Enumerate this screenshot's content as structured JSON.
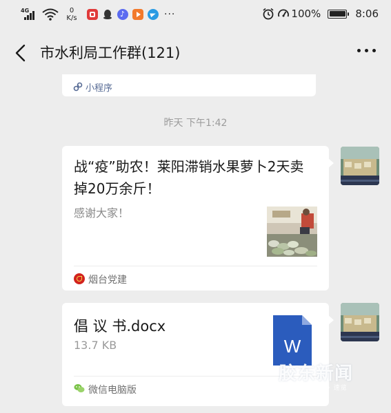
{
  "status_bar": {
    "network_type": "4G",
    "net_speed_value": "0",
    "net_speed_unit": "K/s",
    "battery_percent": "100%",
    "time": "8:06",
    "more_symbol": "···"
  },
  "header": {
    "title": "市水利局工作群(121)"
  },
  "messages": [
    {
      "kind": "mini_program_card",
      "label": "小程序"
    },
    {
      "kind": "timestamp",
      "text": "昨天 下午1:42"
    },
    {
      "kind": "article_card",
      "title": "战“疫”助农！莱阳滞销水果萝卜2天卖掉20万余斤！",
      "description": "感谢大家！",
      "source": "烟台党建",
      "thumbnail_icon": "market-photo"
    },
    {
      "kind": "file_card",
      "file_name": "倡 议 书.docx",
      "file_size": "13.7 KB",
      "file_type_letter": "W",
      "source": "微信电脑版"
    }
  ],
  "watermark": {
    "logo_text": "胶东新闻",
    "sub_text": "要闻 · 速览"
  },
  "colors": {
    "background": "#ededed",
    "card": "#ffffff",
    "word_blue": "#2b5cbd",
    "link_blue": "#576b95"
  }
}
